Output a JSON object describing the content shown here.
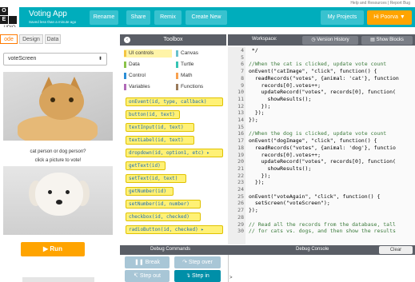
{
  "help_link": "Help and Resources | Report Bug",
  "logo": {
    "cells": [
      "O",
      "",
      "E",
      ""
    ],
    "studio": "UDIO"
  },
  "app": {
    "title": "Voting App",
    "saved": "Saved less than a minute ago"
  },
  "header_buttons": {
    "rename": "Rename",
    "share": "Share",
    "remix": "Remix",
    "create_new": "Create New",
    "my_projects": "My Projects",
    "user": "Hi Poorva ▼"
  },
  "tabs": {
    "code": "ode",
    "design": "Design",
    "data": "Data"
  },
  "screen_selector": {
    "value": "voteScreen",
    "arrow": "⬍"
  },
  "app_preview": {
    "caption1": "cat person or dog person?",
    "caption2": "click a picture to vote!",
    "run_label": "Run",
    "run_icon": "▶"
  },
  "toolbox": {
    "title": "Toolbox",
    "collapse_icon": "‹",
    "categories": [
      {
        "label": "UI controls",
        "color": "#f4c542",
        "selected": true
      },
      {
        "label": "Canvas",
        "color": "#68c1cc"
      },
      {
        "label": "Data",
        "color": "#8bc34a"
      },
      {
        "label": "Turtle",
        "color": "#36c4b4"
      },
      {
        "label": "Control",
        "color": "#2c8ed6"
      },
      {
        "label": "Math",
        "color": "#f8a14f"
      },
      {
        "label": "Variables",
        "color": "#b06ab8"
      },
      {
        "label": "Functions",
        "color": "#9a7a5a"
      }
    ],
    "blocks": [
      "onEvent(id, type, callback)",
      "button(id, text)",
      "textInput(id, text)",
      "textLabel(id, text)",
      "dropdown(id, option1, etc) ▸",
      "getText(id)",
      "setText(id, text)",
      "getNumber(id)",
      "setNumber(id, number)",
      "checkbox(id, checked)",
      "radioButton(id, checked) ▸"
    ]
  },
  "editor": {
    "workspace_label": "Workspace:",
    "version_history": "Version History",
    "show_blocks": "Show Blocks",
    "lines": [
      {
        "n": "4",
        "text": " */"
      },
      {
        "n": "5",
        "text": ""
      },
      {
        "n": "6",
        "text": "//When the cat is clicked, update vote count",
        "comment": true
      },
      {
        "n": "7",
        "text": "onEvent(\"catImage\", \"click\", function() {"
      },
      {
        "n": "8",
        "text": "  readRecords(\"votes\", {animal: 'cat'}, function"
      },
      {
        "n": "9",
        "text": "    records[0].votes++;"
      },
      {
        "n": "10",
        "text": "    updateRecord(\"votes\", records[0], function("
      },
      {
        "n": "11",
        "text": "      showResults();"
      },
      {
        "n": "12",
        "text": "    });"
      },
      {
        "n": "13",
        "text": "  });"
      },
      {
        "n": "14",
        "text": "});"
      },
      {
        "n": "15",
        "text": ""
      },
      {
        "n": "16",
        "text": "//When the dog is clicked, update vote count",
        "comment": true
      },
      {
        "n": "17",
        "text": "onEvent(\"dogImage\", \"click\", function() {"
      },
      {
        "n": "18",
        "text": "  readRecords(\"votes\", {animal: 'dog'}, functio"
      },
      {
        "n": "19",
        "text": "    records[0].votes++;"
      },
      {
        "n": "20",
        "text": "    updateRecord(\"votes\", records[0], function("
      },
      {
        "n": "21",
        "text": "      showResults();"
      },
      {
        "n": "22",
        "text": "    });"
      },
      {
        "n": "23",
        "text": "  });"
      },
      {
        "n": "24",
        "text": ""
      },
      {
        "n": "25",
        "text": "onEvent(\"voteAgain\", \"click\", function() {"
      },
      {
        "n": "26",
        "text": "  setScreen(\"voteScreen\");"
      },
      {
        "n": "27",
        "text": "});"
      },
      {
        "n": "28",
        "text": ""
      },
      {
        "n": "29",
        "text": "// Read all the records from the database, tall",
        "comment": true
      },
      {
        "n": "30",
        "text": "// for cats vs. dogs, and then show the results",
        "comment": true
      }
    ]
  },
  "debug": {
    "commands_label": "Debug Commands",
    "console_label": "Debug Console",
    "clear": "Clear",
    "break": "Break",
    "step_over": "Step over",
    "step_out": "Step out",
    "step_in": "Step in",
    "prompt": ">"
  }
}
